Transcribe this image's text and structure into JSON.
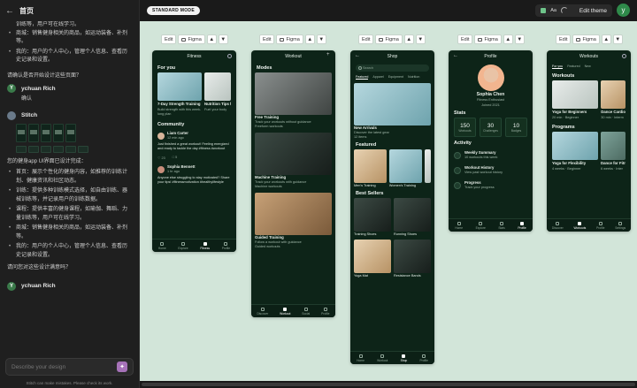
{
  "sidebar": {
    "header_title": "首页",
    "top_lines": [
      "训练等，用户可在线学习。"
    ],
    "top_bullets": [
      "商城：销售健身相关的商品，如运动装备、补剂等。",
      "我的：用户的个人中心，管理个人信息、查看历史记录和设置。"
    ],
    "confirm_question": "请确认是否开始设计这些页面？",
    "user1_name": "ychuan Rich",
    "user1_msg": "确认",
    "assistant_name": "Stitch",
    "summary_intro": "您的健身app UI界面已设计完成：",
    "summary_bullets": [
      "首页：展示个性化的健身内容，如推荐的训练计划、健康资讯和社区动态。",
      "训练：提供多种训练模式选择，如自由训练、器械训练等，并记录用户的训练数据。",
      "课程：提供丰富的健身课程，如瑜伽、舞蹈、力量训练等，用户可在线学习。",
      "商城：销售健身相关的商品，如运动装备、补剂等。",
      "我的：用户的个人中心，管理个人信息、查看历史记录和设置。"
    ],
    "satisfaction_question": "请问您对这些设计满意吗？",
    "user2_name": "ychuan Rich",
    "user_initial": "Y",
    "input_placeholder": "Describe your design",
    "disclaimer": "Stitch can make mistakes. Please check its work."
  },
  "topbar": {
    "mode_badge": "STANDARD MODE",
    "theme_aa": "Aa",
    "edit_theme": "Edit theme",
    "user_initial": "y"
  },
  "toolbar": {
    "edit": "Edit",
    "figma": "Figma"
  },
  "screens": {
    "fitness": {
      "title": "Fitness",
      "for_you": "For you",
      "cards": [
        {
          "title": "7-Day Strength Training",
          "sub": "Build strength with this week-long plan"
        },
        {
          "title": "Nutrition Tips f",
          "sub": "Fuel your body"
        }
      ],
      "community": "Community",
      "posts": [
        {
          "name": "Liam Carter",
          "time": "12 min ago",
          "text": "Just finished a great workout! Feeling energized and ready to tackle the day #fitness #workout",
          "likes": "23",
          "comments": "5"
        },
        {
          "name": "Sophia Bennett",
          "time": "1 hr ago",
          "text": "Anyone else struggling to stay motivated? Share your tips! #fitnessmotivation #healthylifestyle"
        }
      ],
      "tabs": [
        "Home",
        "Explore",
        "Fitness",
        "Profile"
      ]
    },
    "workout": {
      "title": "Workout",
      "modes": "Modes",
      "items": [
        {
          "title": "Free Training",
          "sub": "Track your workouts without guidance",
          "sub2": "Freeform workouts"
        },
        {
          "title": "Machine Training",
          "sub": "Track your workouts with guidance",
          "sub2": "Machine workouts"
        },
        {
          "title": "Guided Training",
          "sub": "Follow a workout with guidance",
          "sub2": "Guided workouts"
        }
      ],
      "tabs": [
        "Discover",
        "Workout",
        "Social",
        "Profile"
      ]
    },
    "shop": {
      "title": "Shop",
      "search_placeholder": "Search",
      "chips": [
        "Featured",
        "Apparel",
        "Equipment",
        "Nutrition"
      ],
      "new_arrivals": "New Arrivals",
      "new_arrivals_sub": "Discover the latest gear",
      "new_arrivals_count": "12 items",
      "featured": "Featured",
      "featured_items": [
        "Men's Training",
        "Women's Training"
      ],
      "best_sellers": "Best Sellers",
      "best_items": [
        "Training Shoes",
        "Running Shoes",
        "Yoga Mat",
        "Resistance Bands"
      ],
      "tabs": [
        "Home",
        "Workout",
        "Shop",
        "Profile"
      ]
    },
    "profile": {
      "title": "Profile",
      "name": "Sophia Chen",
      "role": "Fitness Enthusiast",
      "joined": "Joined 2021",
      "stats_title": "Stats",
      "stats": [
        {
          "value": "150",
          "label": "Workouts"
        },
        {
          "value": "30",
          "label": "Challenges"
        },
        {
          "value": "10",
          "label": "Badges"
        }
      ],
      "activity_title": "Activity",
      "activities": [
        {
          "title": "Weekly Summary",
          "sub": "10 workouts this week"
        },
        {
          "title": "Workout History",
          "sub": "View past workout history"
        },
        {
          "title": "Progress",
          "sub": "Track your progress"
        }
      ],
      "tabs": [
        "Home",
        "Explore",
        "Stats",
        "Profile"
      ]
    },
    "workouts": {
      "title": "Workouts",
      "chips": [
        "For you",
        "Featured",
        "New"
      ],
      "workouts_title": "Workouts",
      "workouts_items": [
        {
          "title": "Yoga for Beginners",
          "sub": "20 min · Beginner"
        },
        {
          "title": "Dance Cardio",
          "sub": "30 min · Interm"
        }
      ],
      "programs_title": "Programs",
      "programs_items": [
        {
          "title": "Yoga for Flexibility",
          "sub": "4 weeks · Beginner"
        },
        {
          "title": "Dance for Fitn",
          "sub": "6 weeks · Inter"
        }
      ],
      "tabs": [
        "Discover",
        "Workouts",
        "Profile",
        "Settings"
      ]
    }
  }
}
